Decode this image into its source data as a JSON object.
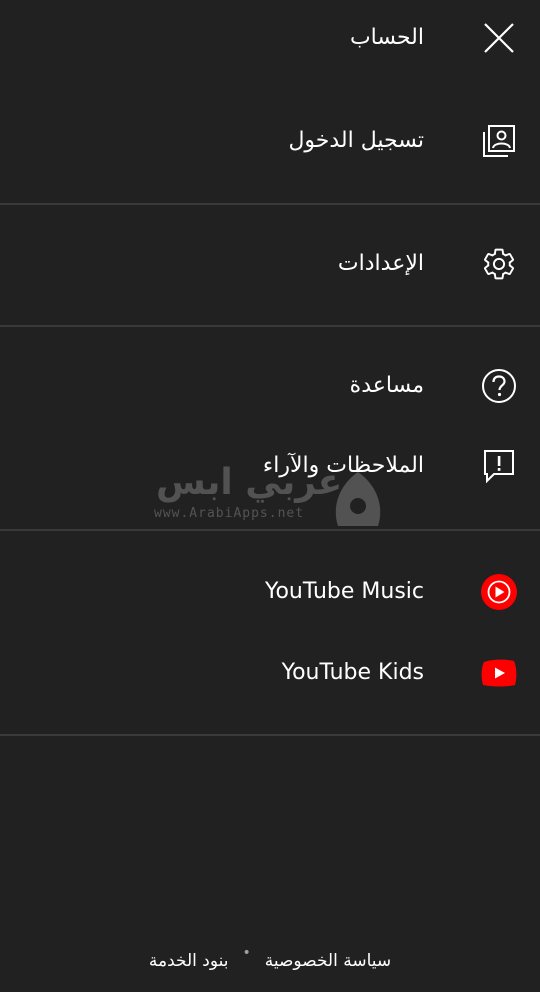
{
  "header": {
    "title": "الحساب",
    "close_icon": "close-icon"
  },
  "menu": {
    "sign_in": {
      "label": "تسجيل الدخول",
      "icon": "account-box-icon"
    },
    "settings": {
      "label": "الإعدادات",
      "icon": "gear-icon"
    },
    "help": {
      "label": "مساعدة",
      "icon": "help-circle-icon"
    },
    "feedback": {
      "label": "الملاحظات والآراء",
      "icon": "feedback-icon"
    },
    "youtube_music": {
      "label": "YouTube Music",
      "icon": "youtube-music-icon"
    },
    "youtube_kids": {
      "label": "YouTube Kids",
      "icon": "youtube-kids-icon"
    }
  },
  "footer": {
    "privacy": "سياسة الخصوصية",
    "separator": "•",
    "terms": "بنود الخدمة"
  },
  "watermark": {
    "text": "عربي ابس",
    "url": "www.ArabiApps.net"
  },
  "colors": {
    "background": "#212121",
    "divider": "#3a3a3a",
    "text": "#ffffff",
    "youtube_red": "#ff0000"
  }
}
